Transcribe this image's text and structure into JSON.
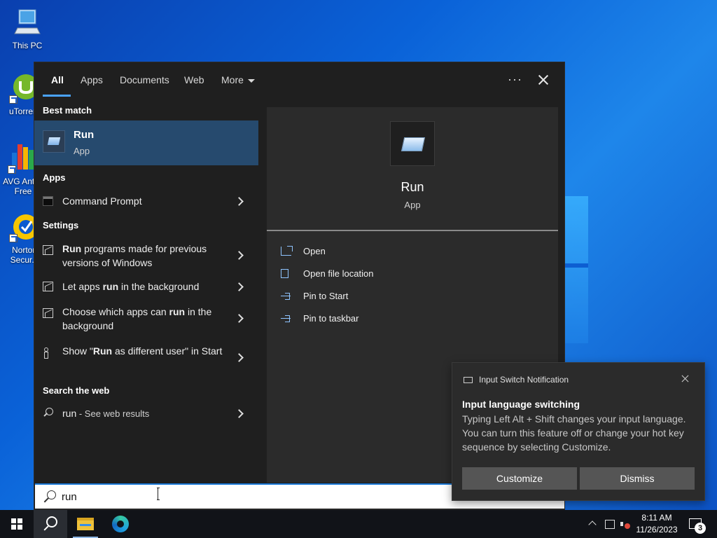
{
  "desktop": {
    "icons": [
      {
        "label": "This PC"
      },
      {
        "label": "uTorrent"
      },
      {
        "label": "AVG Anti... Free"
      },
      {
        "label": "Norton Secur..."
      }
    ]
  },
  "search_panel": {
    "tabs": [
      {
        "label": "All",
        "active": true
      },
      {
        "label": "Apps"
      },
      {
        "label": "Documents"
      },
      {
        "label": "Web"
      },
      {
        "label": "More"
      }
    ],
    "more_options_label": "···",
    "sections": {
      "best_match": "Best match",
      "apps": "Apps",
      "settings": "Settings",
      "search_web": "Search the web"
    },
    "best_match": {
      "title": "Run",
      "subtitle": "App"
    },
    "apps": [
      {
        "label": "Command Prompt"
      }
    ],
    "settings": [
      {
        "pre": "",
        "bold": "Run",
        "post": " programs made for previous versions of Windows"
      },
      {
        "pre": "Let apps ",
        "bold": "run",
        "post": " in the background"
      },
      {
        "pre": "Choose which apps can ",
        "bold": "run",
        "post": " in the background"
      },
      {
        "pre": "Show \"",
        "bold": "Run",
        "post": " as different user\" in Start"
      }
    ],
    "web": {
      "query": "run",
      "suffix": " - See web results"
    },
    "detail": {
      "title": "Run",
      "subtitle": "App",
      "actions": [
        {
          "label": "Open",
          "icon": "open-icon"
        },
        {
          "label": "Open file location",
          "icon": "file-icon"
        },
        {
          "label": "Pin to Start",
          "icon": "pin-icon"
        },
        {
          "label": "Pin to taskbar",
          "icon": "pin-icon"
        }
      ]
    },
    "search_input": {
      "value": "run"
    }
  },
  "notification": {
    "header": "Input Switch Notification",
    "title": "Input language switching",
    "body": "Typing Left Alt + Shift changes your input language. You can turn this feature off or change your hot key sequence by selecting Customize.",
    "buttons": {
      "customize": "Customize",
      "dismiss": "Dismiss"
    }
  },
  "taskbar": {
    "time": "8:11 AM",
    "date": "11/26/2023",
    "notification_count": "3"
  },
  "colors": {
    "accent": "#4aa3ff",
    "selected_row": "#264a6e",
    "panel_bg": "#1f1f1f",
    "detail_bg": "#2b2b2b",
    "taskbar_bg": "#111318"
  }
}
